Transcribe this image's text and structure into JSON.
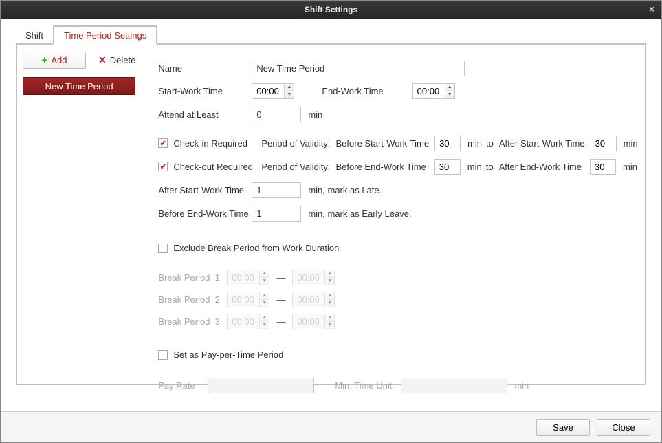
{
  "window": {
    "title": "Shift Settings"
  },
  "tabs": [
    {
      "label": "Shift",
      "active": false
    },
    {
      "label": "Time Period Settings",
      "active": true
    }
  ],
  "toolbar": {
    "add_label": "Add",
    "delete_label": "Delete"
  },
  "list": {
    "items": [
      "New Time Period"
    ]
  },
  "form": {
    "labels": {
      "name": "Name",
      "start_work_time": "Start-Work Time",
      "end_work_time": "End-Work Time",
      "attend_at_least": "Attend at Least",
      "min": "min",
      "min_unit": "min",
      "to": "to",
      "checkin_required": "Check-in Required",
      "checkout_required": "Check-out Required",
      "period_of_validity": "Period of Validity:",
      "before_start_work_time": "Before Start-Work Time",
      "after_start_work_time": "After Start-Work Time",
      "before_end_work_time": "Before End-Work Time",
      "after_end_work_time": "After End-Work Time",
      "after_start_work_time_row": "After Start-Work Time",
      "before_end_work_time_row": "Before End-Work Time",
      "mark_as_late": "min,  mark as Late.",
      "mark_as_early_leave": "min,  mark as Early Leave.",
      "exclude_break": "Exclude Break Period from Work Duration",
      "break_period": "Break Period",
      "set_pay_per_time": "Set as Pay-per-Time Period",
      "pay_rate": "Pay Rate",
      "min_time_unit": "Min. Time Unit"
    },
    "values": {
      "name": "New Time Period",
      "start_work_time": "00:00",
      "end_work_time": "00:00",
      "attend_at_least": "0",
      "checkin_required": true,
      "checkout_required": true,
      "before_start": "30",
      "after_start": "30",
      "before_end": "30",
      "after_end": "30",
      "late_threshold": "1",
      "early_threshold": "1",
      "exclude_break": false,
      "set_pay": false,
      "pay_rate": "",
      "min_time_unit": "",
      "breaks": [
        {
          "idx": "1",
          "from": "00:00",
          "to": "00:00"
        },
        {
          "idx": "2",
          "from": "00:00",
          "to": "00:00"
        },
        {
          "idx": "3",
          "from": "00:00",
          "to": "00:00"
        }
      ]
    }
  },
  "footer": {
    "save_label": "Save",
    "close_label": "Close"
  }
}
